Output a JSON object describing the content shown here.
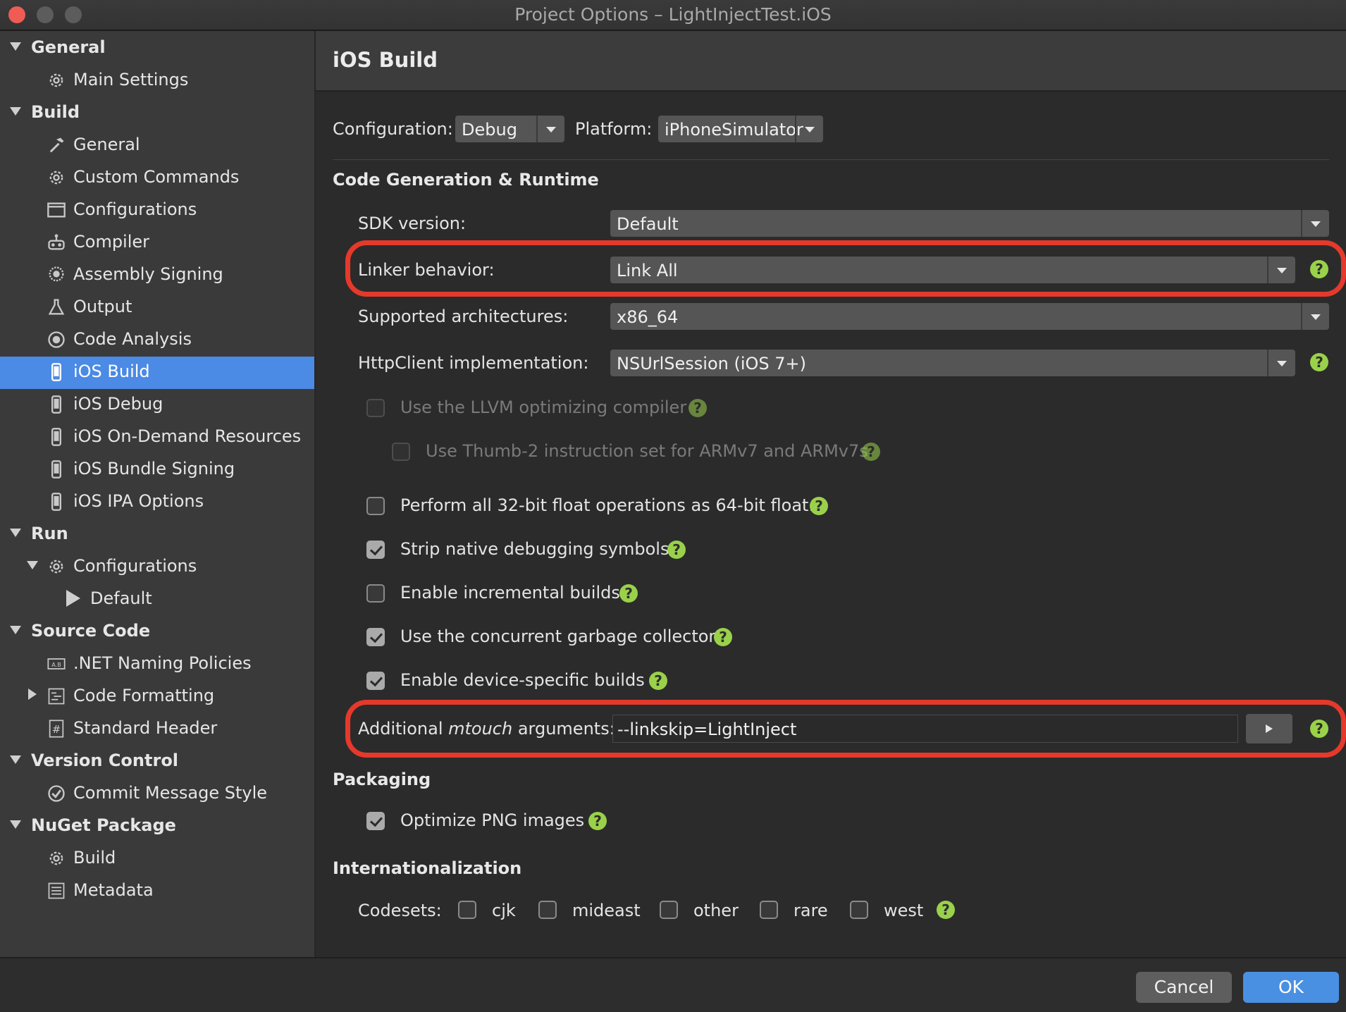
{
  "window": {
    "title": "Project Options – LightInjectTest.iOS"
  },
  "sidebar": {
    "general": {
      "label": "General",
      "main_settings": "Main Settings"
    },
    "build": {
      "label": "Build",
      "items": [
        "General",
        "Custom Commands",
        "Configurations",
        "Compiler",
        "Assembly Signing",
        "Output",
        "Code Analysis",
        "iOS Build",
        "iOS Debug",
        "iOS On-Demand Resources",
        "iOS Bundle Signing",
        "iOS IPA Options"
      ],
      "selected": "iOS Build"
    },
    "run": {
      "label": "Run",
      "configurations": "Configurations",
      "default": "Default"
    },
    "source_code": {
      "label": "Source Code",
      "items": [
        ".NET Naming Policies",
        "Code Formatting",
        "Standard Header"
      ]
    },
    "version_control": {
      "label": "Version Control",
      "items": [
        "Commit Message Style"
      ]
    },
    "nuget_package": {
      "label": "NuGet Package",
      "items": [
        "Build",
        "Metadata"
      ]
    }
  },
  "main": {
    "title": "iOS Build",
    "configuration": {
      "label": "Configuration:",
      "value": "Debug"
    },
    "platform": {
      "label": "Platform:",
      "value": "iPhoneSimulator"
    },
    "code_gen_section": "Code Generation & Runtime",
    "sdk_version": {
      "label": "SDK version:",
      "value": "Default"
    },
    "linker_behavior": {
      "label": "Linker behavior:",
      "value": "Link All"
    },
    "supported_arch": {
      "label": "Supported architectures:",
      "value": "x86_64"
    },
    "httpclient": {
      "label": "HttpClient implementation:",
      "value": "NSUrlSession (iOS 7+)"
    },
    "options": {
      "llvm": "Use the LLVM optimizing compiler",
      "thumb2": "Use Thumb-2 instruction set for ARMv7 and ARMv7s",
      "float32": "Perform all 32-bit float operations as 64-bit float.",
      "strip_symbols": "Strip native debugging symbols",
      "incremental": "Enable incremental builds",
      "concurrent_gc": "Use the concurrent garbage collector",
      "device_specific": "Enable device-specific builds"
    },
    "mtouch": {
      "label_prefix": "Additional ",
      "label_italic": "mtouch",
      "label_suffix": " arguments:",
      "value": "--linkskip=LightInject"
    },
    "packaging_section": "Packaging",
    "optimize_png": "Optimize PNG images",
    "i18n_section": "Internationalization",
    "codesets": {
      "label": "Codesets:",
      "items": [
        "cjk",
        "mideast",
        "other",
        "rare",
        "west"
      ]
    },
    "help_glyph": "?"
  },
  "footer": {
    "cancel": "Cancel",
    "ok": "OK"
  },
  "colors": {
    "accent": "#4a90e2",
    "selection": "#4b8ae5",
    "help": "#9ad14a",
    "highlight": "#e5392b"
  }
}
